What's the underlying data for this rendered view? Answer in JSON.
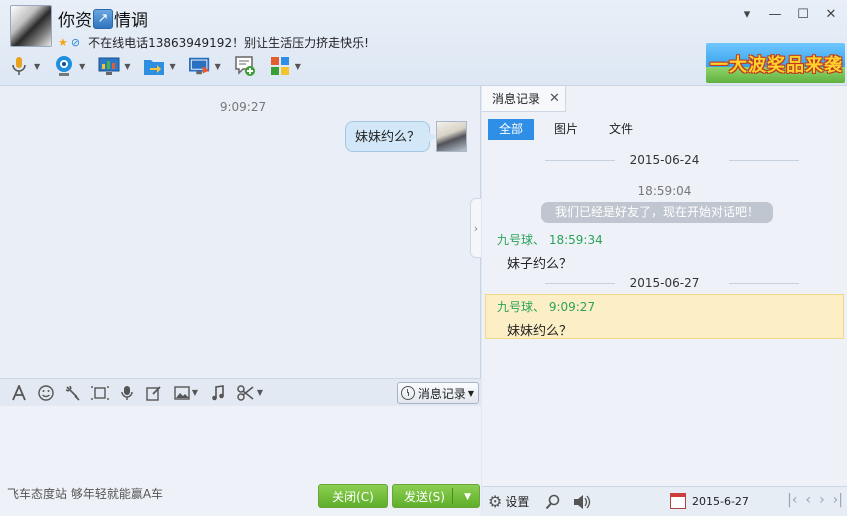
{
  "header": {
    "title_part1": "你资",
    "title_glyph": "↗",
    "title_part2": "情调",
    "status_text": "不在线电话13863949192！别让生活压力挤走快乐!",
    "banner_text": "一大波奖品来袭"
  },
  "window_controls": [
    "▾",
    "—",
    "☐",
    "✕"
  ],
  "toolbar": [
    {
      "icon": "microphone-icon",
      "color": "#e8a21c"
    },
    {
      "icon": "webcam-icon",
      "color": "#1d8ee0"
    },
    {
      "icon": "remote-desktop-icon",
      "color": "#2c78c8"
    },
    {
      "icon": "file-transfer-icon",
      "color": "#2e8fe0"
    },
    {
      "icon": "screen-share-icon",
      "color": "#2a6fc0"
    },
    {
      "icon": "new-chat-icon",
      "color": "#38a036"
    },
    {
      "icon": "apps-icon",
      "color": "#e45d2d"
    }
  ],
  "chat": {
    "time": "9:09:27",
    "message": "妹妹约么？"
  },
  "input_toolbar": {
    "icons": [
      "font-icon",
      "emoji-icon",
      "shake-icon",
      "screenshot-icon",
      "voice-icon",
      "edit-icon",
      "image-icon",
      "music-icon",
      "scissors-icon"
    ],
    "history_label": "消息记录"
  },
  "footer": {
    "ad_text": "飞车态度站 够年轻就能赢A车",
    "close_label": "关闭(C)",
    "send_label": "发送(S)"
  },
  "history": {
    "tab_label": "消息记录",
    "filters": [
      "全部",
      "图片",
      "文件"
    ],
    "date1": "2015-06-24",
    "sys_time": "18:59:04",
    "sys_notice": "我们已经是好友了，现在开始对话吧！",
    "msg1_sender": "九号球、 18:59:34",
    "msg1_text": "妹子约么？",
    "date2": "2015-06-27",
    "msg2_sender": "九号球、 9:09:27",
    "msg2_text": "妹妹约么？",
    "settings_label": "设置",
    "date_value": "2015-6-27"
  }
}
